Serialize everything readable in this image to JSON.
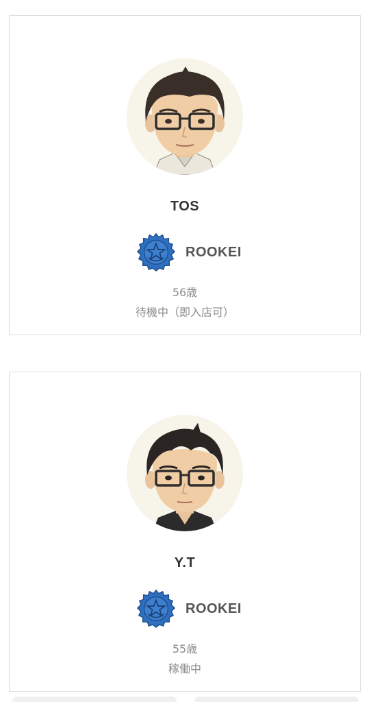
{
  "cards": [
    {
      "name": "TOS",
      "rank": "ROOKEI",
      "age": "56歳",
      "status": "待機中（即入店可）"
    },
    {
      "name": "Y.T",
      "rank": "ROOKEI",
      "age": "55歳",
      "status": "稼働中"
    }
  ],
  "colors": {
    "badge_blue": "#2f6fbf",
    "text_dark": "#333333",
    "text_muted": "#8a8a8a",
    "border": "#dcdcdc"
  },
  "icons": [
    "avatar-illustration",
    "rank-badge-icon"
  ]
}
